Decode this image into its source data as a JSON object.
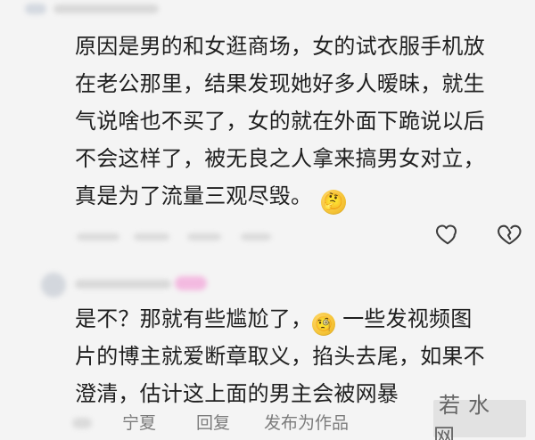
{
  "comments": [
    {
      "lines": [
        "原因是男的和女逛商场，女的试衣服手机放",
        "在老公那里，结果发现她好多人暧昧，就生",
        "气说啥也不买了，女的就在外面下跪说以后",
        "不会这样了，被无良之人拿来搞男女对立，",
        "真是为了流量三观尽毁。"
      ],
      "emoji_icon": "thinking-face-icon",
      "emoji_color": "#f5c437"
    },
    {
      "lines": {
        "first_before": "是不？那就有些尴尬了，",
        "first_after": "一些发视频图",
        "second": "片的博主就爱断章取义，掐头去尾，如果不",
        "third": "澄清，估计这上面的男主会被网暴"
      },
      "emoji_icon": "face-with-monocle-icon",
      "emoji_color": "#f5c437"
    }
  ],
  "actions": {
    "like_icon": "heart-outline-icon",
    "dislike_icon": "broken-heart-outline-icon"
  },
  "bottom": {
    "location": "宁夏",
    "reply": "回复",
    "publish": "发布为作品"
  },
  "watermark": "若水网",
  "colors": {
    "background": "#f4f4f4",
    "text": "#1f1f1f",
    "muted_text": "#7c7c7c",
    "watermark_bg": "#e0e0e0",
    "blur_pink": "#f3a7da"
  }
}
